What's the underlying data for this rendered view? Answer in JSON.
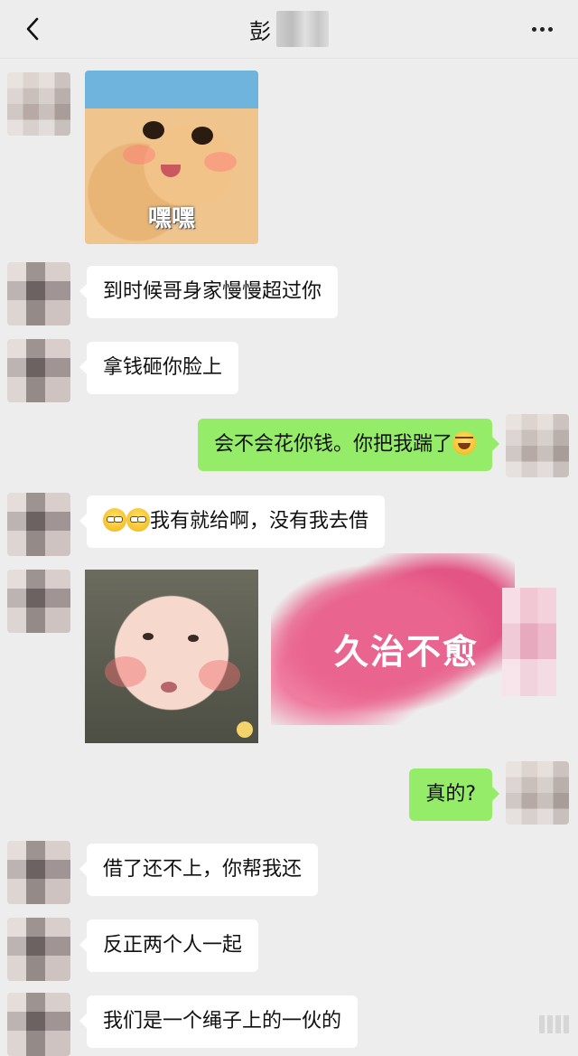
{
  "header": {
    "title": "彭",
    "back_icon": "chevron-left-icon",
    "more_icon": "more-dots-icon"
  },
  "messages": [
    {
      "sender": "other",
      "type": "sticker",
      "label": "嘿嘿"
    },
    {
      "sender": "other",
      "type": "text",
      "text": "到时候哥身家慢慢超过你"
    },
    {
      "sender": "other",
      "type": "text",
      "text": "拿钱砸你脸上"
    },
    {
      "sender": "me",
      "type": "text",
      "text": "会不会花你钱。你把我踹了",
      "emoji": "laughing-tears-emoji"
    },
    {
      "sender": "other",
      "type": "text",
      "text": "我有就给啊，没有我去借",
      "emoji": "side-eye-emoji"
    },
    {
      "sender": "other",
      "type": "sticker",
      "label": ""
    },
    {
      "sender": "me",
      "type": "sticker",
      "label": "久治不愈"
    },
    {
      "sender": "me",
      "type": "text",
      "text": "真的?"
    },
    {
      "sender": "other",
      "type": "text",
      "text": "借了还不上，你帮我还"
    },
    {
      "sender": "other",
      "type": "text",
      "text": "反正两个人一起"
    },
    {
      "sender": "other",
      "type": "text",
      "text": "我们是一个绳子上的一伙的"
    }
  ],
  "colors": {
    "background": "#ededed",
    "incoming_bubble": "#ffffff",
    "outgoing_bubble": "#95ec69"
  }
}
